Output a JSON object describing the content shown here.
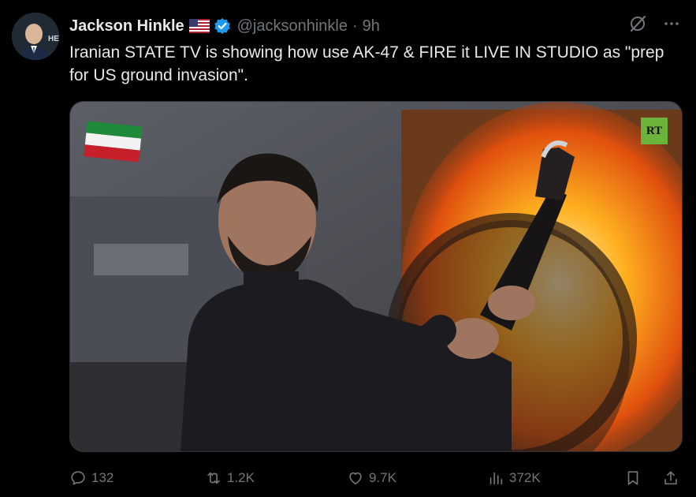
{
  "author": {
    "name": "Jackson Hinkle",
    "handle": "@jacksonhinkle",
    "separator": "·",
    "time": "9h",
    "flag_icon": "us-flag-icon",
    "verified_icon": "verified-badge-icon"
  },
  "tweet": {
    "text": "Iranian STATE TV is showing how use AK-47 & FIRE it LIVE IN STUDIO as \"prep for US ground invasion\"."
  },
  "media": {
    "watermark": "RT"
  },
  "actions": {
    "replies": "132",
    "reposts": "1.2K",
    "likes": "9.7K",
    "views": "372K"
  },
  "colors": {
    "background": "#000000",
    "text": "#e7e9ea",
    "muted": "#71767b",
    "verified": "#1d9bf0"
  }
}
